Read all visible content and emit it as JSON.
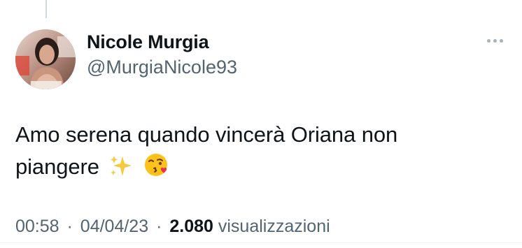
{
  "tweet": {
    "author": {
      "display_name": "Nicole Murgia",
      "handle": "@MurgiaNicole93",
      "avatar_icon": "profile-photo"
    },
    "more_icon": "more-horizontal-icon",
    "text": "Amo serena quando vincerà Oriana non piangere",
    "emojis": [
      "sparkles-emoji",
      "face-blowing-kiss-emoji"
    ],
    "time": "00:58",
    "date": "04/04/23",
    "separator": "·",
    "views_count": "2.080",
    "views_label": "visualizzazioni"
  },
  "colors": {
    "text_primary": "#0f1419",
    "text_secondary": "#536471",
    "thread_line": "#cfd9de"
  }
}
